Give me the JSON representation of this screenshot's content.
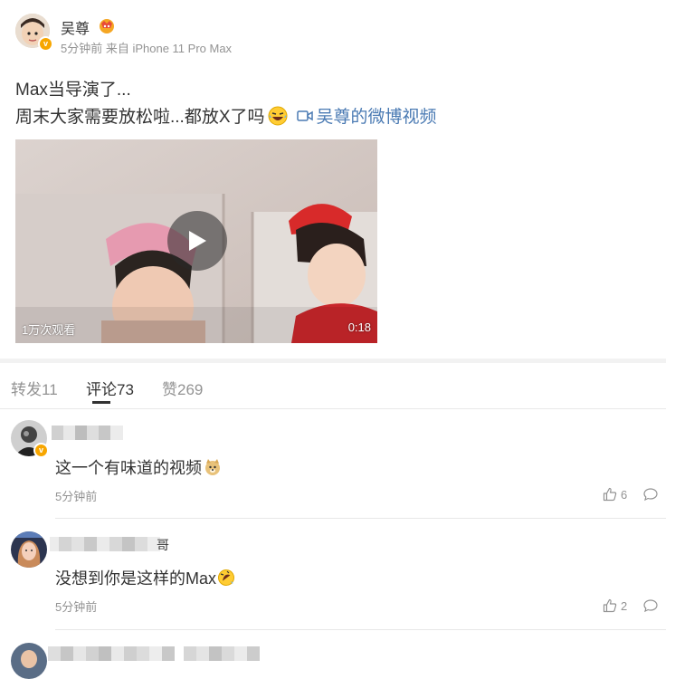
{
  "post": {
    "author": "吴尊",
    "meta": "5分钟前 来自 iPhone 11 Pro Max",
    "line1": "Max当导演了...",
    "line2": "周末大家需要放松啦...都放X了吗",
    "video_link": "吴尊的微博视频",
    "video": {
      "views": "1万次观看",
      "duration": "0:18"
    }
  },
  "tabs": [
    {
      "label": "转发11"
    },
    {
      "label": "评论73"
    },
    {
      "label": "赞269"
    }
  ],
  "active_tab": 1,
  "comments": [
    {
      "text": "这一个有味道的视频",
      "time": "5分钟前",
      "likes": "6"
    },
    {
      "name_suffix": "哥",
      "text": "没想到你是这样的Max",
      "time": "5分钟前",
      "likes": "2"
    },
    {
      "text": ""
    }
  ],
  "colors": {
    "link": "#4a7ab3",
    "badge": "#f7a600",
    "muted": "#939393",
    "tab_indicator": "#333333"
  }
}
